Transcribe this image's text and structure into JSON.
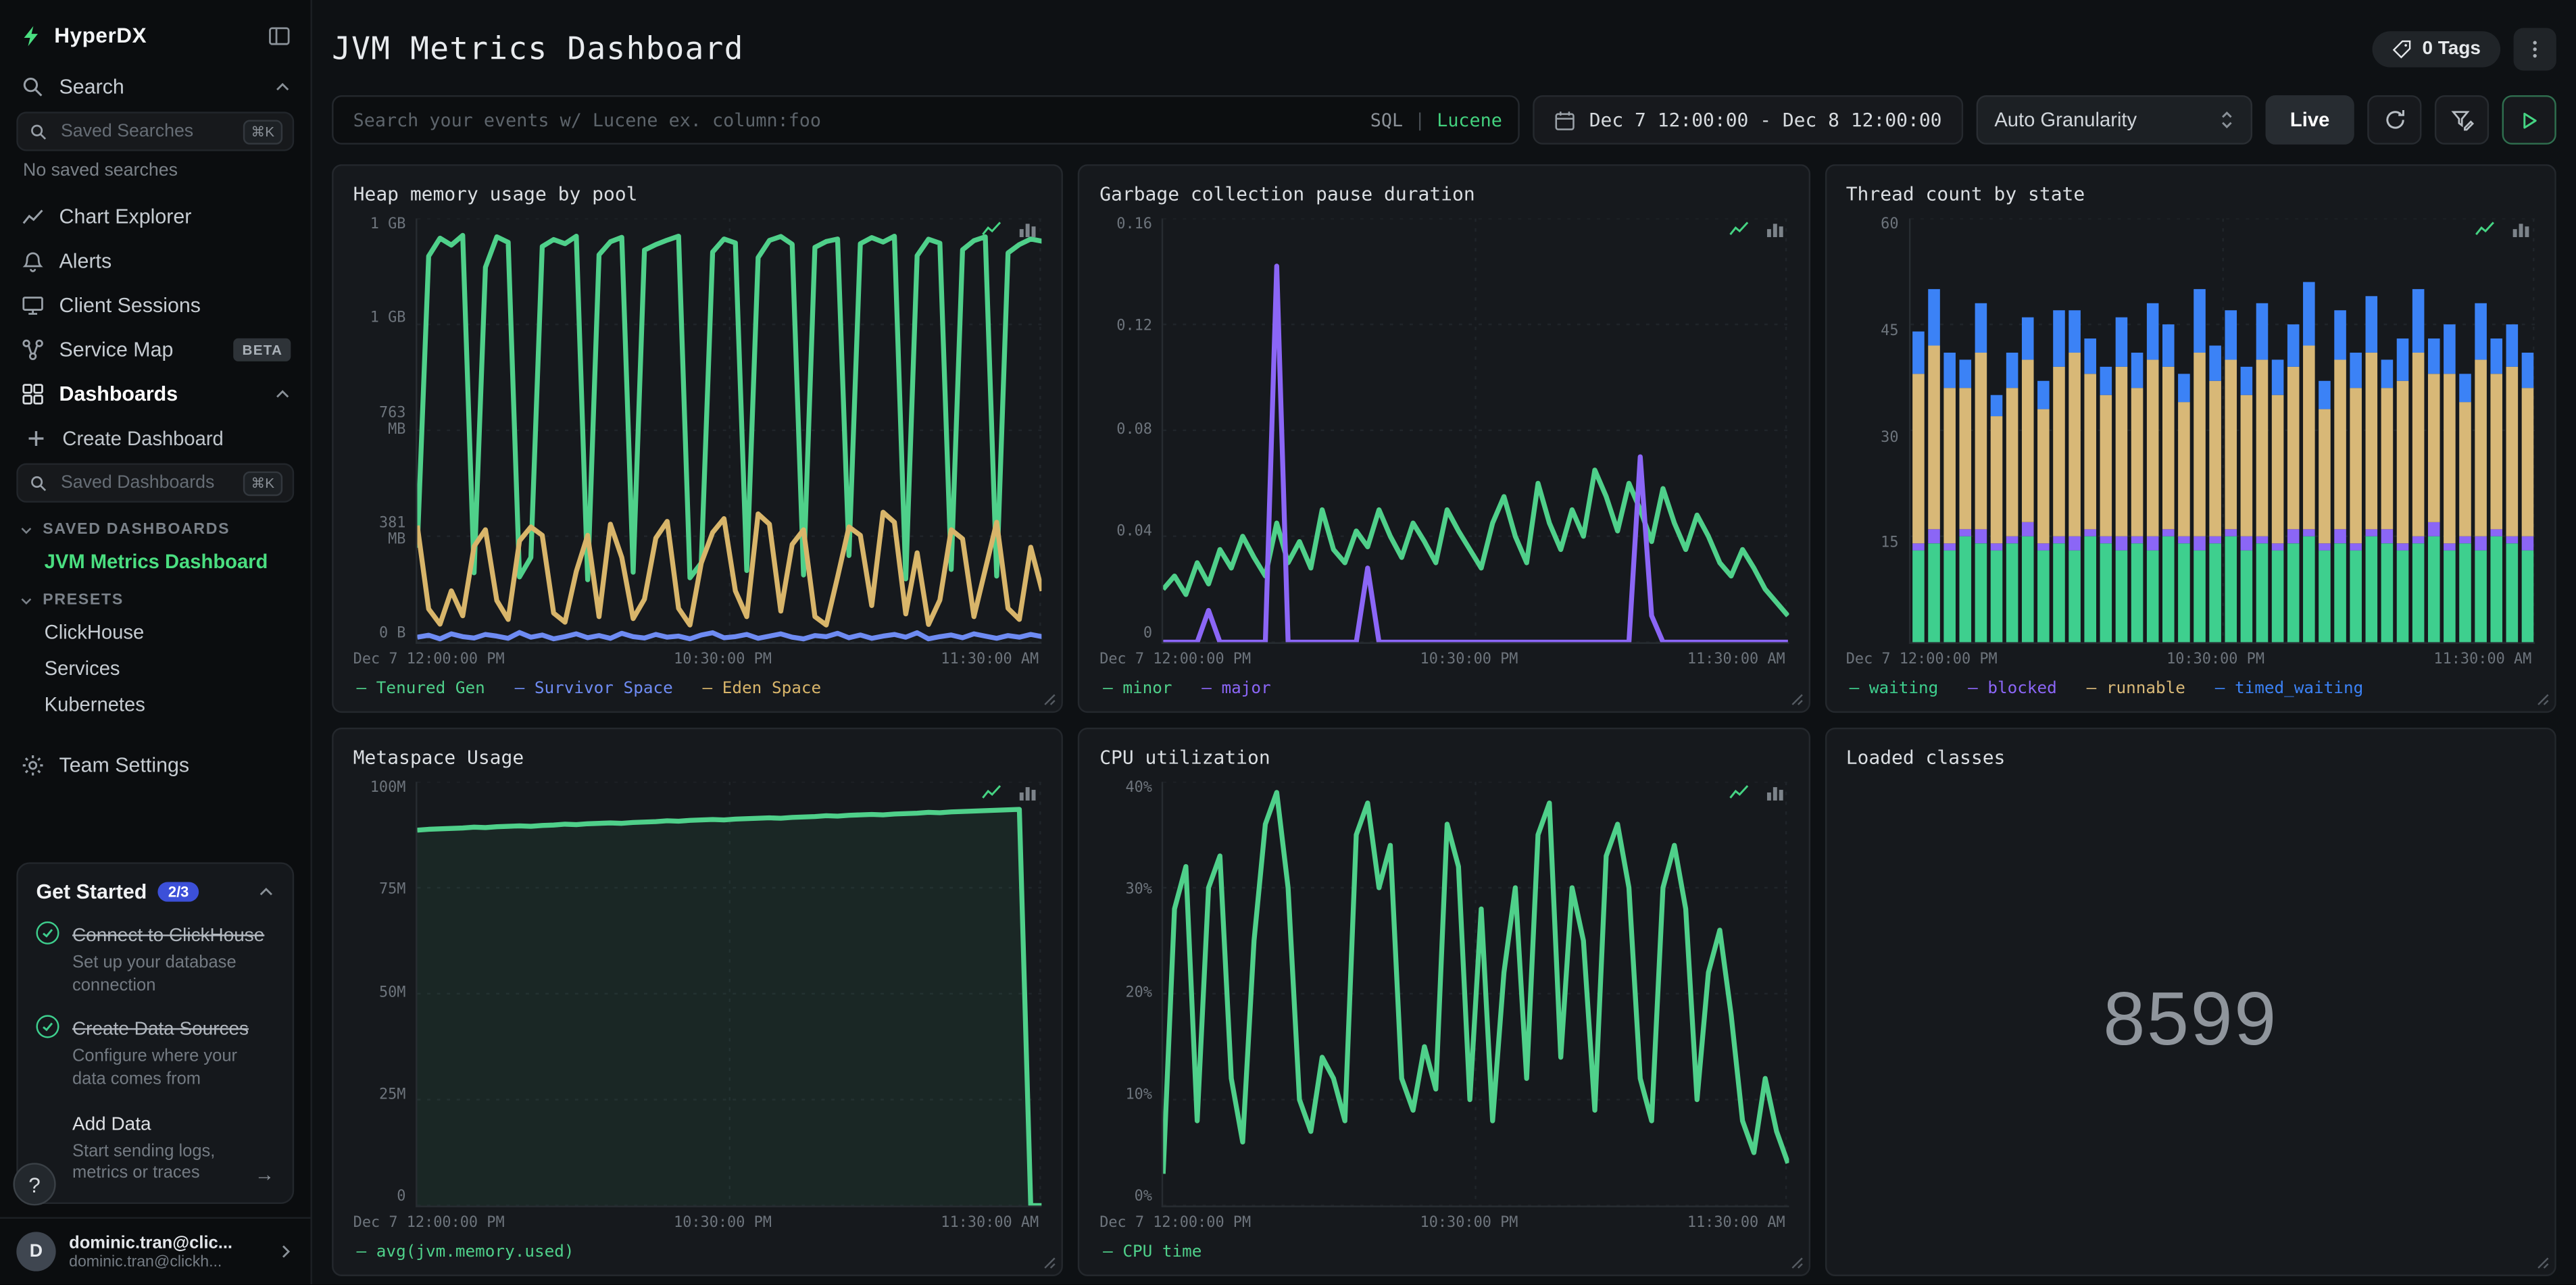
{
  "app": {
    "accent": "#45d483"
  },
  "sidebar": {
    "brand": "HyperDX",
    "search_label": "Search",
    "saved_searches_placeholder": "Saved Searches",
    "shortcut": "⌘K",
    "no_saved_searches": "No saved searches",
    "chart_explorer": "Chart Explorer",
    "alerts": "Alerts",
    "client_sessions": "Client Sessions",
    "service_map": "Service Map",
    "beta_badge": "BETA",
    "dashboards": "Dashboards",
    "create_dashboard": "Create Dashboard",
    "saved_dashboards_placeholder": "Saved Dashboards",
    "saved_dashboards_heading": "SAVED DASHBOARDS",
    "active_dashboard": "JVM Metrics Dashboard",
    "presets_heading": "PRESETS",
    "presets": [
      "ClickHouse",
      "Services",
      "Kubernetes"
    ],
    "team_settings": "Team Settings",
    "get_started": {
      "title": "Get Started",
      "progress": "2/3",
      "tasks": [
        {
          "title": "Connect to ClickHouse",
          "sub": "Set up your database connection"
        },
        {
          "title": "Create Data Sources",
          "sub": "Configure where your data comes from"
        },
        {
          "title": "Add Data",
          "sub": "Start sending logs, metrics or traces"
        }
      ]
    },
    "help": "?",
    "user": {
      "initial": "D",
      "name": "dominic.tran@clic...",
      "email": "dominic.tran@clickh..."
    }
  },
  "header": {
    "title": "JVM Metrics Dashboard",
    "tags": "0 Tags"
  },
  "toolbar": {
    "search_placeholder": "Search your events w/ Lucene ex. column:foo",
    "sql": "SQL",
    "divider": "|",
    "lucene": "Lucene",
    "date_range": "Dec 7 12:00:00 - Dec 8 12:00:00",
    "granularity": "Auto Granularity",
    "live": "Live"
  },
  "chart_data": [
    {
      "type": "line",
      "title": "Heap memory usage by pool",
      "ylim": [
        0,
        1526
      ],
      "yticks": [
        "1 GB",
        "1 GB",
        "763 MB",
        "381 MB",
        "0 B"
      ],
      "xticks": [
        "Dec 7 12:00:00 PM",
        "10:30:00 PM",
        "11:30:00 AM"
      ],
      "series": [
        {
          "name": "Tenured Gen",
          "color": "#4fd08a",
          "values": [
            340,
            1390,
            1455,
            1430,
            1465,
            250,
            1350,
            1460,
            1440,
            235,
            305,
            1425,
            1450,
            1435,
            1462,
            225,
            1395,
            1442,
            1458,
            252,
            1412,
            1432,
            1448,
            1462,
            232,
            285,
            1405,
            1452,
            1438,
            258,
            1385,
            1447,
            1461,
            1433,
            242,
            1422,
            1443,
            1452,
            312,
            1435,
            1457,
            1441,
            1462,
            228,
            1392,
            1451,
            1437,
            262,
            1413,
            1446,
            1460,
            238,
            1402,
            1432,
            1452,
            1444
          ]
        },
        {
          "name": "Survivor Space",
          "color": "#6e8bf2",
          "values": [
            18,
            25,
            12,
            30,
            20,
            15,
            28,
            22,
            14,
            35,
            18,
            26,
            12,
            20,
            30,
            16,
            24,
            14,
            32,
            20,
            15,
            28,
            18,
            22,
            12,
            26,
            34,
            16,
            20,
            28,
            14,
            22,
            30,
            18,
            12,
            24,
            20,
            32,
            16,
            26,
            14,
            22,
            28,
            18,
            34,
            12,
            20,
            26,
            16,
            30,
            22,
            14,
            24,
            18,
            28,
            20
          ]
        },
        {
          "name": "Eden Space",
          "color": "#d8b56a",
          "values": [
            420,
            120,
            65,
            185,
            95,
            345,
            405,
            150,
            82,
            365,
            415,
            385,
            105,
            72,
            255,
            385,
            92,
            425,
            305,
            85,
            155,
            375,
            435,
            122,
            62,
            285,
            395,
            445,
            185,
            92,
            462,
            425,
            112,
            352,
            405,
            92,
            62,
            235,
            415,
            385,
            132,
            468,
            432,
            102,
            322,
            64,
            152,
            405,
            372,
            92,
            262,
            432,
            122,
            82,
            342,
            185
          ]
        }
      ]
    },
    {
      "type": "line",
      "title": "Garbage collection pause duration",
      "ylim": [
        0,
        0.16
      ],
      "yticks": [
        "0.16",
        "0.12",
        "0.08",
        "0.04",
        "0"
      ],
      "xticks": [
        "Dec 7 12:00:00 PM",
        "10:30:00 PM",
        "11:30:00 AM"
      ],
      "series": [
        {
          "name": "minor",
          "color": "#4fd08a",
          "values": [
            0.02,
            0.025,
            0.018,
            0.03,
            0.022,
            0.035,
            0.028,
            0.04,
            0.032,
            0.025,
            0.045,
            0.03,
            0.038,
            0.028,
            0.05,
            0.035,
            0.03,
            0.042,
            0.036,
            0.05,
            0.04,
            0.032,
            0.045,
            0.038,
            0.03,
            0.05,
            0.042,
            0.035,
            0.028,
            0.045,
            0.055,
            0.04,
            0.03,
            0.06,
            0.045,
            0.035,
            0.05,
            0.04,
            0.065,
            0.055,
            0.042,
            0.06,
            0.05,
            0.038,
            0.058,
            0.045,
            0.035,
            0.048,
            0.04,
            0.03,
            0.025,
            0.035,
            0.028,
            0.02,
            0.015,
            0.01
          ]
        },
        {
          "name": "major",
          "color": "#8b66f6",
          "values": [
            0,
            0,
            0,
            0,
            0.012,
            0,
            0,
            0,
            0,
            0,
            0.142,
            0,
            0,
            0,
            0,
            0,
            0,
            0,
            0.028,
            0,
            0,
            0,
            0,
            0,
            0,
            0,
            0,
            0,
            0,
            0,
            0,
            0,
            0,
            0,
            0,
            0,
            0,
            0,
            0,
            0,
            0,
            0,
            0.07,
            0.01,
            0,
            0,
            0,
            0,
            0,
            0,
            0,
            0,
            0,
            0,
            0,
            0
          ]
        }
      ]
    },
    {
      "type": "stacked-bar",
      "title": "Thread count by state",
      "ylim": [
        0,
        60
      ],
      "yticks": [
        "60",
        "45",
        "30",
        "15",
        ""
      ],
      "xticks": [
        "Dec 7 12:00:00 PM",
        "10:30:00 PM",
        "11:30:00 AM"
      ],
      "series": [
        {
          "name": "waiting",
          "color": "#3ecf8e",
          "values": [
            13,
            14,
            13,
            15,
            14,
            13,
            14,
            15,
            13,
            14,
            13,
            15,
            14,
            13,
            14,
            13,
            15,
            14,
            13,
            14,
            15,
            13,
            14,
            13,
            14,
            15,
            13,
            14,
            13,
            15,
            14,
            13,
            14,
            15,
            13,
            14,
            13,
            15,
            14,
            13
          ]
        },
        {
          "name": "blocked",
          "color": "#8b66f6",
          "values": [
            1,
            2,
            1,
            1,
            2,
            1,
            1,
            2,
            1,
            1,
            2,
            1,
            1,
            2,
            1,
            2,
            1,
            1,
            2,
            1,
            1,
            2,
            1,
            1,
            2,
            1,
            1,
            2,
            1,
            1,
            2,
            1,
            1,
            2,
            1,
            1,
            2,
            1,
            1,
            2
          ]
        },
        {
          "name": "runnable",
          "color": "#d8b877",
          "values": [
            24,
            26,
            22,
            20,
            25,
            18,
            21,
            23,
            19,
            24,
            26,
            22,
            20,
            24,
            21,
            25,
            23,
            19,
            26,
            22,
            24,
            20,
            25,
            21,
            23,
            26,
            19,
            24,
            22,
            25,
            20,
            23,
            26,
            21,
            24,
            19,
            25,
            22,
            24,
            21
          ]
        },
        {
          "name": "timed_waiting",
          "color": "#3b82f6",
          "values": [
            6,
            8,
            5,
            4,
            7,
            3,
            5,
            6,
            4,
            8,
            6,
            5,
            4,
            7,
            5,
            8,
            6,
            4,
            9,
            5,
            7,
            4,
            8,
            5,
            6,
            9,
            4,
            7,
            5,
            8,
            4,
            6,
            9,
            5,
            7,
            4,
            8,
            5,
            6,
            5
          ]
        }
      ]
    },
    {
      "type": "line",
      "title": "Metaspace Usage",
      "ylim": [
        0,
        100
      ],
      "yticks": [
        "100M",
        "75M",
        "50M",
        "25M",
        "0"
      ],
      "xticks": [
        "Dec 7 12:00:00 PM",
        "10:30:00 PM",
        "11:30:00 AM"
      ],
      "series": [
        {
          "name": "avg(jvm.memory.used)",
          "color": "#4fd08a",
          "area": true,
          "values": [
            88.6,
            88.8,
            88.9,
            89.0,
            89.1,
            89.3,
            89.2,
            89.4,
            89.5,
            89.6,
            89.5,
            89.7,
            89.8,
            90.0,
            89.9,
            90.1,
            90.2,
            90.3,
            90.2,
            90.4,
            90.5,
            90.6,
            90.8,
            90.7,
            90.9,
            91.0,
            91.1,
            91.0,
            91.2,
            91.3,
            91.4,
            91.5,
            91.4,
            91.6,
            91.7,
            91.8,
            92.0,
            91.9,
            92.1,
            92.2,
            92.3,
            92.2,
            92.4,
            92.5,
            92.6,
            92.8,
            92.7,
            92.9,
            93.0,
            93.1,
            93.2,
            93.3,
            93.4,
            93.5,
            0,
            0
          ]
        }
      ]
    },
    {
      "type": "line",
      "title": "CPU utilization",
      "ylim": [
        0,
        40
      ],
      "yticks": [
        "40%",
        "30%",
        "20%",
        "10%",
        "0%"
      ],
      "xticks": [
        "Dec 7 12:00:00 PM",
        "10:30:00 PM",
        "11:30:00 AM"
      ],
      "series": [
        {
          "name": "CPU time",
          "color": "#4fd08a",
          "values": [
            3,
            28,
            32,
            8,
            30,
            33,
            12,
            6,
            25,
            36,
            39,
            30,
            10,
            7,
            14,
            12,
            8,
            35,
            38,
            30,
            34,
            12,
            9,
            15,
            11,
            36,
            32,
            10,
            28,
            8,
            22,
            30,
            12,
            35,
            38,
            14,
            30,
            25,
            9,
            33,
            36,
            30,
            12,
            8,
            30,
            34,
            28,
            10,
            22,
            26,
            18,
            8,
            5,
            12,
            7,
            4
          ]
        }
      ]
    },
    {
      "type": "number",
      "title": "Loaded classes",
      "value": "8599"
    }
  ]
}
